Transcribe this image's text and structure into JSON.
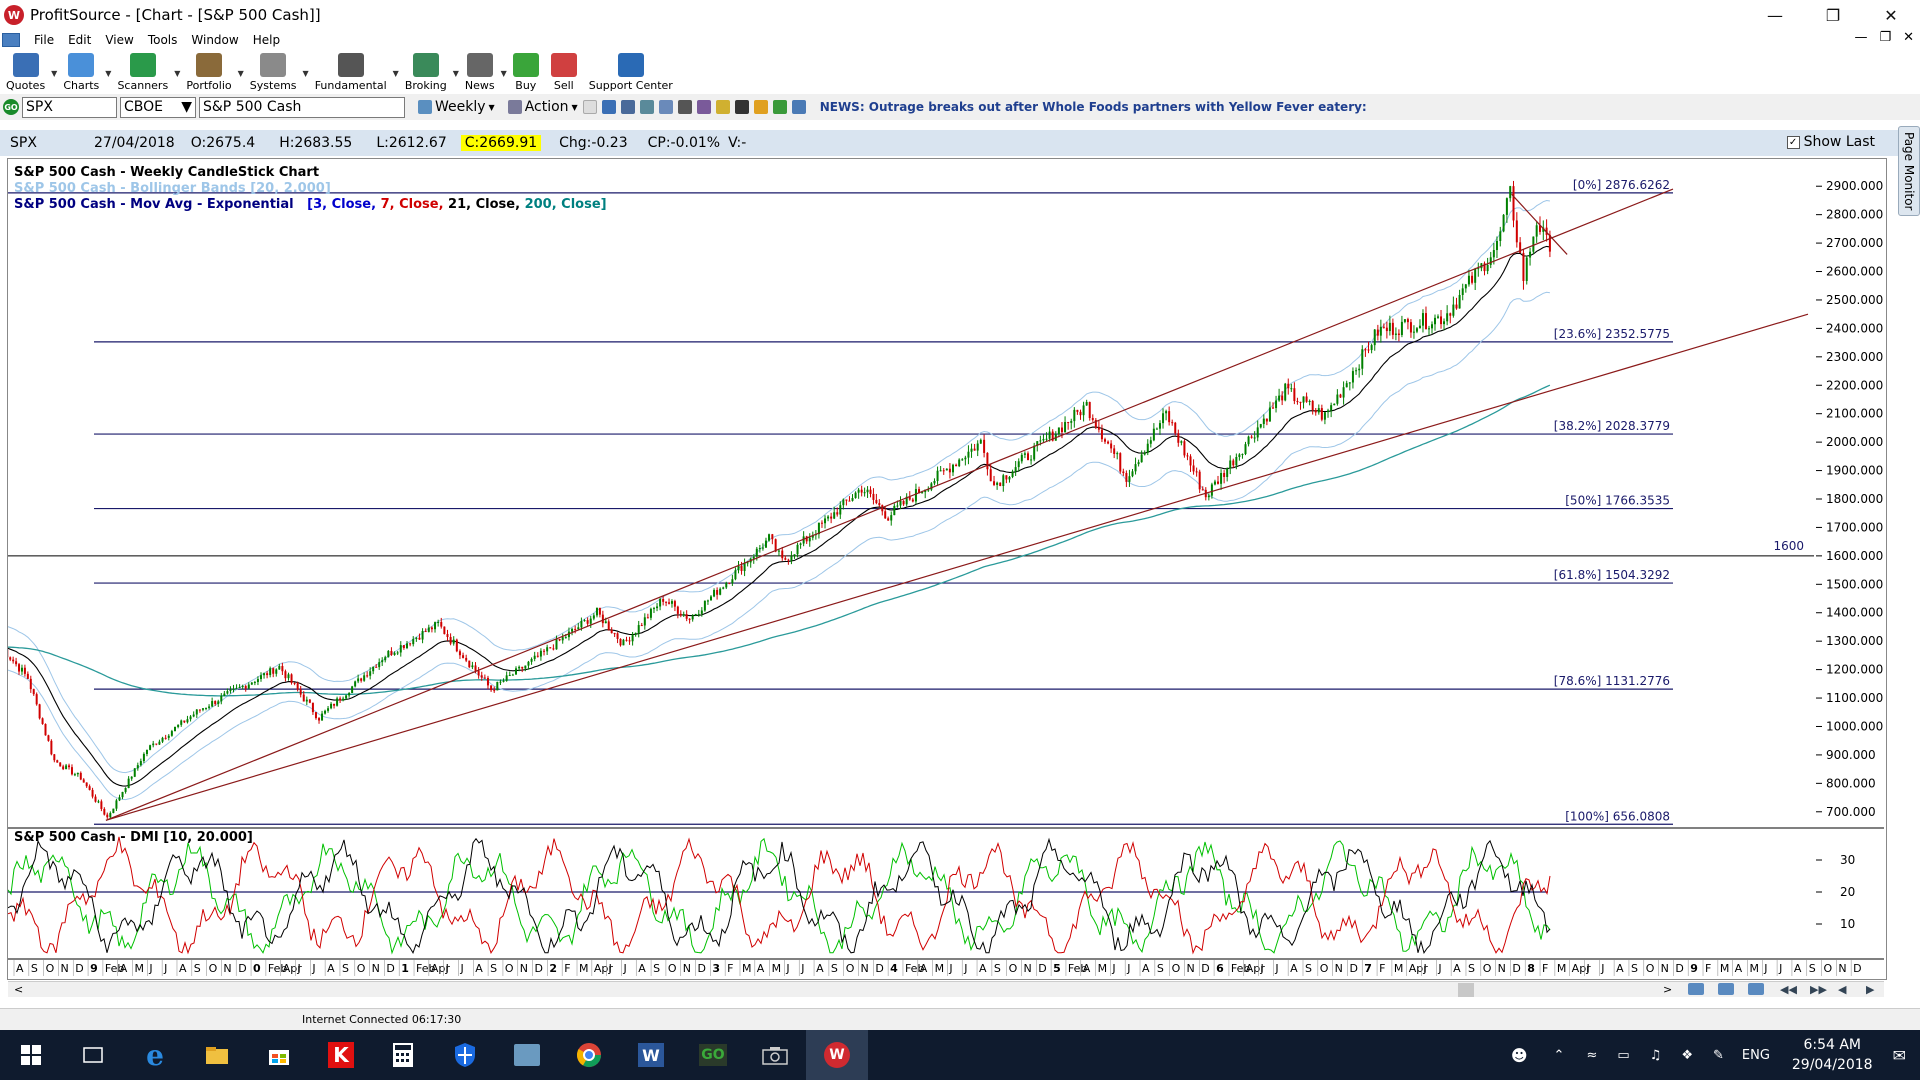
{
  "window": {
    "title": "ProfitSource - [Chart -  [S&P 500 Cash]]",
    "logo_letter": "W"
  },
  "menu": [
    "File",
    "Edit",
    "View",
    "Tools",
    "Window",
    "Help"
  ],
  "toolbar": [
    {
      "label": "Quotes",
      "color": "#3a6fb5",
      "dropdown": true
    },
    {
      "label": "Charts",
      "color": "#4a90d9",
      "dropdown": true
    },
    {
      "label": "Scanners",
      "color": "#2a9a4a",
      "dropdown": true
    },
    {
      "label": "Portfolio",
      "color": "#8a6a3a",
      "dropdown": true
    },
    {
      "label": "Systems",
      "color": "#8a8a8a",
      "dropdown": true
    },
    {
      "label": "Fundamental",
      "color": "#555555",
      "dropdown": true
    },
    {
      "label": "Broking",
      "color": "#3a8a5a",
      "dropdown": true
    },
    {
      "label": "News",
      "color": "#666666",
      "dropdown": true
    },
    {
      "label": "Buy",
      "color": "#3aa53a",
      "dropdown": false
    },
    {
      "label": "Sell",
      "color": "#d04040",
      "dropdown": false
    },
    {
      "label": "Support Center",
      "color": "#2a6ab5",
      "dropdown": false
    }
  ],
  "symbolbar": {
    "go_label": "GO",
    "symbol": "SPX",
    "exchange": "CBOE",
    "security_name": "S&P 500 Cash",
    "period": "Weekly",
    "action_label": "Action",
    "news": "NEWS: Outrage breaks out after Whole Foods partners with Yellow Fever eatery:"
  },
  "quote": {
    "symbol": "SPX",
    "date": "27/04/2018",
    "open": "O:2675.4",
    "high": "H:2683.55",
    "low": "L:2612.67",
    "close": "C:2669.91",
    "change": "Chg:-0.23",
    "change_pct": "CP:-0.01%",
    "volume": "V:-",
    "show_last_label": "Show Last",
    "show_last_checked": "✓"
  },
  "page_monitor_label": "Page Monitor",
  "legend": {
    "line1": "S&P 500 Cash - Weekly CandleStick Chart",
    "line2": "S&P 500 Cash - Bollinger Bands [20, 2.000]",
    "line3_prefix": "S&P 500 Cash - Mov Avg - Exponential",
    "ema_parts": [
      {
        "text": "[3, Close,",
        "color": "#0000cc"
      },
      {
        "text": "7, Close,",
        "color": "#d00000"
      },
      {
        "text": "21, Close,",
        "color": "#000000"
      },
      {
        "text": "200, Close]",
        "color": "#008080"
      }
    ],
    "dmi": "S&P 500 Cash - DMI [10, 20.000]"
  },
  "colors": {
    "fib_line": "#1a1a6a",
    "trendline": "#8b1a1a",
    "bollinger": "#9ec6e8",
    "ema21": "#000000",
    "ema200": "#2a9a9a",
    "candle_up": "#008000",
    "candle_down": "#d00000",
    "dmi_plus": "#00c000",
    "dmi_minus": "#d00000",
    "adx": "#000000"
  },
  "chart_data": {
    "type": "candlestick",
    "y_range": [
      650,
      2950
    ],
    "y_ticks": [
      "2900.000",
      "2800.000",
      "2700.000",
      "2600.000",
      "2500.000",
      "2400.000",
      "2300.000",
      "2200.000",
      "2100.000",
      "2000.000",
      "1900.000",
      "1800.000",
      "1700.000",
      "1600.000",
      "1500.000",
      "1400.000",
      "1300.000",
      "1200.000",
      "1100.000",
      "1000.000",
      "900.000",
      "800.000",
      "700.000"
    ],
    "fib_levels": [
      {
        "label": "[0%] 2876.6262",
        "value": 2876.6262
      },
      {
        "label": "[23.6%] 2352.5775",
        "value": 2352.5775
      },
      {
        "label": "[38.2%] 2028.3779",
        "value": 2028.3779
      },
      {
        "label": "[50%] 1766.3535",
        "value": 1766.3535
      },
      {
        "label": "[61.8%] 1504.3292",
        "value": 1504.3292
      },
      {
        "label": "[78.6%] 1131.2776",
        "value": 1131.2776
      },
      {
        "label": "[100%] 656.0808",
        "value": 656.0808
      }
    ],
    "hline_1600": {
      "label": "1600",
      "value": 1600
    },
    "price_path": [
      [
        "2008-07",
        1280
      ],
      [
        "2008-09",
        1170
      ],
      [
        "2008-11",
        880
      ],
      [
        "2009-01",
        820
      ],
      [
        "2009-03",
        680
      ],
      [
        "2009-06",
        920
      ],
      [
        "2009-10",
        1060
      ],
      [
        "2010-04",
        1210
      ],
      [
        "2010-07",
        1030
      ],
      [
        "2010-12",
        1250
      ],
      [
        "2011-04",
        1360
      ],
      [
        "2011-08",
        1130
      ],
      [
        "2011-12",
        1260
      ],
      [
        "2012-04",
        1400
      ],
      [
        "2012-06",
        1290
      ],
      [
        "2012-09",
        1450
      ],
      [
        "2012-11",
        1380
      ],
      [
        "2013-05",
        1660
      ],
      [
        "2013-06",
        1580
      ],
      [
        "2013-12",
        1840
      ],
      [
        "2014-02",
        1740
      ],
      [
        "2014-09",
        2000
      ],
      [
        "2014-10",
        1850
      ],
      [
        "2015-05",
        2130
      ],
      [
        "2015-08",
        1880
      ],
      [
        "2015-11",
        2100
      ],
      [
        "2016-02",
        1810
      ],
      [
        "2016-08",
        2180
      ],
      [
        "2016-11",
        2090
      ],
      [
        "2017-03",
        2390
      ],
      [
        "2017-08",
        2440
      ],
      [
        "2017-12",
        2690
      ],
      [
        "2018-01",
        2872
      ],
      [
        "2018-02",
        2580
      ],
      [
        "2018-03",
        2780
      ],
      [
        "2018-04",
        2670
      ]
    ],
    "dmi_ticks": [
      "30",
      "20",
      "10"
    ],
    "dmi_range": [
      0,
      40
    ],
    "dmi_threshold": 20,
    "time_labels": [
      "A",
      "S",
      "O",
      "N",
      "D",
      "9",
      "Feb",
      "A",
      "M",
      "J",
      "J",
      "A",
      "S",
      "O",
      "N",
      "D",
      "0",
      "Feb",
      "Apr",
      "J",
      "J",
      "A",
      "S",
      "O",
      "N",
      "D",
      "1",
      "Feb",
      "Apr",
      "J",
      "J",
      "A",
      "S",
      "O",
      "N",
      "D",
      "2",
      "F",
      "M",
      "Apr",
      "J",
      "J",
      "A",
      "S",
      "O",
      "N",
      "D",
      "3",
      "F",
      "M",
      "A",
      "M",
      "J",
      "J",
      "A",
      "S",
      "O",
      "N",
      "D",
      "4",
      "Feb",
      "A",
      "M",
      "J",
      "J",
      "A",
      "S",
      "O",
      "N",
      "D",
      "5",
      "Feb",
      "A",
      "M",
      "J",
      "J",
      "A",
      "S",
      "O",
      "N",
      "D",
      "6",
      "Feb",
      "Apr",
      "J",
      "J",
      "A",
      "S",
      "O",
      "N",
      "D",
      "7",
      "F",
      "M",
      "Apr",
      "J",
      "J",
      "A",
      "S",
      "O",
      "N",
      "D",
      "8",
      "F",
      "M",
      "Apr",
      "J",
      "J",
      "A",
      "S",
      "O",
      "N",
      "D",
      "9",
      "F",
      "M",
      "A",
      "M",
      "J",
      "J",
      "A",
      "S",
      "O",
      "N",
      "D"
    ]
  },
  "scroll_prev": "<",
  "scroll_next": ">",
  "status": {
    "connection": "Internet Connected 06:17:30"
  },
  "taskbar": {
    "time": "6:54 AM",
    "date": "29/04/2018",
    "lang": "ENG"
  }
}
